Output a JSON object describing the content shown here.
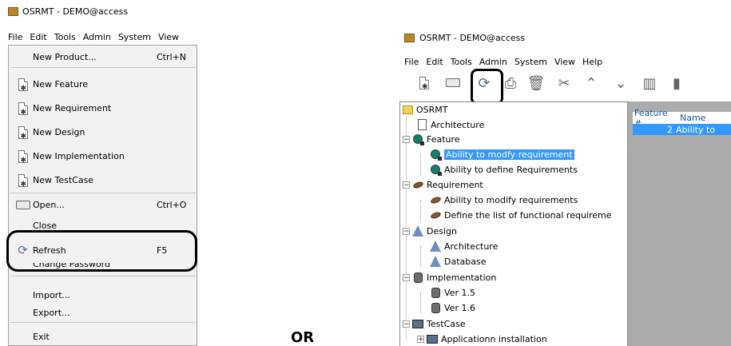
{
  "left": {
    "title": "OSRMT - DEMO@access",
    "menubar": [
      "File",
      "Edit",
      "Tools",
      "Admin",
      "System",
      "View"
    ],
    "menu": {
      "new_product": {
        "label": "New Product...",
        "shortcut": "Ctrl+N"
      },
      "new_feature": "New Feature",
      "new_requirement": "New Requirement",
      "new_design": "New Design",
      "new_implementation": "New Implementation",
      "new_testcase": "New TestCase",
      "open": {
        "label": "Open...",
        "shortcut": "Ctrl+O"
      },
      "close": "Close",
      "refresh": {
        "label": "Refresh",
        "shortcut": "F5"
      },
      "change_password": "Change Password",
      "import": "Import...",
      "export": "Export...",
      "exit": "Exit"
    }
  },
  "or_label": "OR",
  "right": {
    "title": "OSRMT - DEMO@access",
    "menubar": [
      "File",
      "Edit",
      "Tools",
      "Admin",
      "System",
      "View",
      "Help"
    ],
    "toolbar_icons": [
      "new-document-icon",
      "open-folder-icon",
      "refresh-icon",
      "print-icon",
      "delete-icon",
      "cut-icon",
      "move-up-icon",
      "move-down-icon",
      "columns-icon",
      "filter-icon"
    ],
    "tree": {
      "root": "OSRMT",
      "architecture": "Architecture",
      "feature": "Feature",
      "feature_children": [
        "Ability to modfy requirement",
        "Ability to define Requirements"
      ],
      "requirement": "Requirement",
      "requirement_children": [
        "Ability to modify requirements",
        "Define the list of functional requireme"
      ],
      "design": "Design",
      "design_children": [
        "Architecture",
        "Database"
      ],
      "implementation": "Implementation",
      "implementation_children": [
        "Ver 1.5",
        "Ver 1.6"
      ],
      "testcase": "TestCase",
      "testcase_children": [
        "Applicationn installation"
      ]
    },
    "table": {
      "columns": [
        "Feature #",
        "Name"
      ],
      "row": [
        "2",
        "Ability to"
      ]
    }
  }
}
